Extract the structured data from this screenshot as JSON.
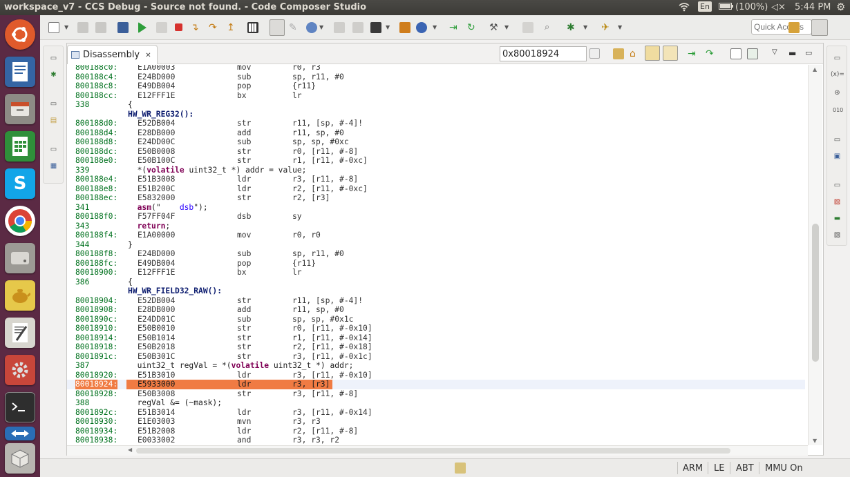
{
  "window": {
    "title": "workspace_v7 - CCS Debug - Source not found. - Code Composer Studio"
  },
  "system_tray": {
    "keyboard": "En",
    "battery": "(100%)",
    "time": "5:44 PM"
  },
  "toolbar": {
    "quick_access_placeholder": "Quick Access"
  },
  "view": {
    "tab_label": "Disassembly",
    "address": "0x80018924"
  },
  "status": {
    "arch": "ARM",
    "endian": "LE",
    "mode": "ABT",
    "mmu": "MMU On"
  },
  "accent": {
    "current_line": "#f07b43",
    "address_green": "#00711e",
    "keyword": "#7f0055",
    "launcher_bg": "#5b2a44"
  },
  "lines": [
    {
      "kind": "ins",
      "addr": "800188c0:",
      "opcode": "E1A00003",
      "mnem": "mov",
      "operands": "r0, r3"
    },
    {
      "kind": "ins",
      "addr": "800188c4:",
      "opcode": "E24BD000",
      "mnem": "sub",
      "operands": "sp, r11, #0"
    },
    {
      "kind": "ins",
      "addr": "800188c8:",
      "opcode": "E49DB004",
      "mnem": "pop",
      "operands": "{r11}"
    },
    {
      "kind": "ins",
      "addr": "800188cc:",
      "opcode": "E12FFF1E",
      "mnem": "bx",
      "operands": "lr"
    },
    {
      "kind": "src",
      "lnum": "338",
      "text": "{"
    },
    {
      "kind": "fn",
      "text": "HW_WR_REG32():"
    },
    {
      "kind": "ins",
      "addr": "800188d0:",
      "opcode": "E52DB004",
      "mnem": "str",
      "operands": "r11, [sp, #-4]!"
    },
    {
      "kind": "ins",
      "addr": "800188d4:",
      "opcode": "E28DB000",
      "mnem": "add",
      "operands": "r11, sp, #0"
    },
    {
      "kind": "ins",
      "addr": "800188d8:",
      "opcode": "E24DD00C",
      "mnem": "sub",
      "operands": "sp, sp, #0xc"
    },
    {
      "kind": "ins",
      "addr": "800188dc:",
      "opcode": "E50B0008",
      "mnem": "str",
      "operands": "r0, [r11, #-8]"
    },
    {
      "kind": "ins",
      "addr": "800188e0:",
      "opcode": "E50B100C",
      "mnem": "str",
      "operands": "r1, [r11, #-0xc]"
    },
    {
      "kind": "src",
      "lnum": "339",
      "pre": "  *(",
      "kw": "volatile",
      "post": " uint32_t *) addr = value;"
    },
    {
      "kind": "ins",
      "addr": "800188e4:",
      "opcode": "E51B3008",
      "mnem": "ldr",
      "operands": "r3, [r11, #-8]"
    },
    {
      "kind": "ins",
      "addr": "800188e8:",
      "opcode": "E51B200C",
      "mnem": "ldr",
      "operands": "r2, [r11, #-0xc]"
    },
    {
      "kind": "ins",
      "addr": "800188ec:",
      "opcode": "E5832000",
      "mnem": "str",
      "operands": "r2, [r3]"
    },
    {
      "kind": "src",
      "lnum": "341",
      "pre": "  ",
      "kw": "asm",
      "post": "(\"    ",
      "strv": "dsb",
      "post2": "\");"
    },
    {
      "kind": "ins",
      "addr": "800188f0:",
      "opcode": "F57FF04F",
      "mnem": "dsb",
      "operands": "sy"
    },
    {
      "kind": "src",
      "lnum": "343",
      "pre": "  ",
      "kw": "return",
      "post": ";"
    },
    {
      "kind": "ins",
      "addr": "800188f4:",
      "opcode": "E1A00000",
      "mnem": "mov",
      "operands": "r0, r0"
    },
    {
      "kind": "src",
      "lnum": "344",
      "text": "}"
    },
    {
      "kind": "ins",
      "addr": "800188f8:",
      "opcode": "E24BD000",
      "mnem": "sub",
      "operands": "sp, r11, #0"
    },
    {
      "kind": "ins",
      "addr": "800188fc:",
      "opcode": "E49DB004",
      "mnem": "pop",
      "operands": "{r11}"
    },
    {
      "kind": "ins",
      "addr": "80018900:",
      "opcode": "E12FFF1E",
      "mnem": "bx",
      "operands": "lr"
    },
    {
      "kind": "src",
      "lnum": "386",
      "text": "{"
    },
    {
      "kind": "fn",
      "text": "HW_WR_FIELD32_RAW():"
    },
    {
      "kind": "ins",
      "addr": "80018904:",
      "opcode": "E52DB004",
      "mnem": "str",
      "operands": "r11, [sp, #-4]!"
    },
    {
      "kind": "ins",
      "addr": "80018908:",
      "opcode": "E28DB000",
      "mnem": "add",
      "operands": "r11, sp, #0"
    },
    {
      "kind": "ins",
      "addr": "8001890c:",
      "opcode": "E24DD01C",
      "mnem": "sub",
      "operands": "sp, sp, #0x1c"
    },
    {
      "kind": "ins",
      "addr": "80018910:",
      "opcode": "E50B0010",
      "mnem": "str",
      "operands": "r0, [r11, #-0x10]"
    },
    {
      "kind": "ins",
      "addr": "80018914:",
      "opcode": "E50B1014",
      "mnem": "str",
      "operands": "r1, [r11, #-0x14]"
    },
    {
      "kind": "ins",
      "addr": "80018918:",
      "opcode": "E50B2018",
      "mnem": "str",
      "operands": "r2, [r11, #-0x18]"
    },
    {
      "kind": "ins",
      "addr": "8001891c:",
      "opcode": "E50B301C",
      "mnem": "str",
      "operands": "r3, [r11, #-0x1c]"
    },
    {
      "kind": "src",
      "lnum": "387",
      "pre": "  uint32_t regVal = *(",
      "kw": "volatile",
      "post": " uint32_t *) addr;"
    },
    {
      "kind": "ins",
      "addr": "80018920:",
      "opcode": "E51B3010",
      "mnem": "ldr",
      "operands": "r3, [r11, #-0x10]"
    },
    {
      "kind": "ins",
      "addr": "80018924:",
      "opcode": "E5933000",
      "mnem": "ldr",
      "operands": "r3, [r3]",
      "current": true
    },
    {
      "kind": "ins",
      "addr": "80018928:",
      "opcode": "E50B3008",
      "mnem": "str",
      "operands": "r3, [r11, #-8]"
    },
    {
      "kind": "src",
      "lnum": "388",
      "pre": "  regVal &= (~mask);"
    },
    {
      "kind": "ins",
      "addr": "8001892c:",
      "opcode": "E51B3014",
      "mnem": "ldr",
      "operands": "r3, [r11, #-0x14]"
    },
    {
      "kind": "ins",
      "addr": "80018930:",
      "opcode": "E1E03003",
      "mnem": "mvn",
      "operands": "r3, r3"
    },
    {
      "kind": "ins",
      "addr": "80018934:",
      "opcode": "E51B2008",
      "mnem": "ldr",
      "operands": "r2, [r11, #-8]"
    },
    {
      "kind": "ins",
      "addr": "80018938:",
      "opcode": "E0033002",
      "mnem": "and",
      "operands": "r3, r3, r2"
    }
  ]
}
